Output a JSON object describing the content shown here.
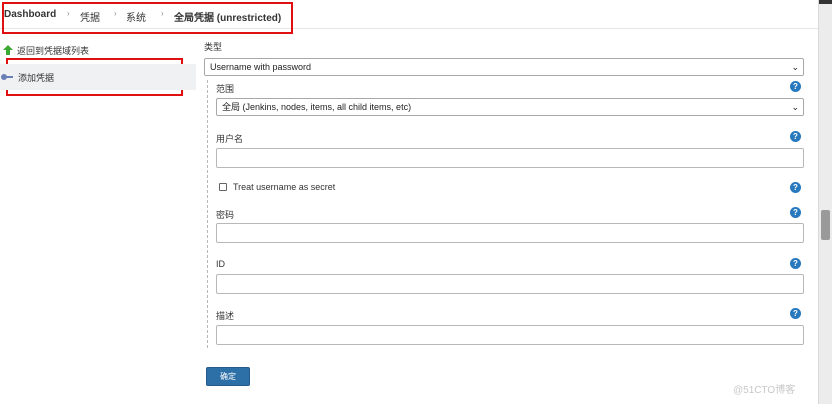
{
  "breadcrumb": {
    "items": [
      "Dashboard",
      "凭据",
      "系统",
      "全局凭据 (unrestricted)"
    ]
  },
  "sidebar": {
    "back_label": "返回到凭据域列表",
    "add_label": "添加凭据"
  },
  "form": {
    "type_label": "类型",
    "type_value": "Username with password",
    "scope_label": "范围",
    "scope_value": "全局 (Jenkins, nodes, items, all child items, etc)",
    "username_label": "用户名",
    "secret_label": "Treat username as secret",
    "password_label": "密码",
    "id_label": "ID",
    "description_label": "描述",
    "submit_label": "确定",
    "help_glyph": "?"
  },
  "watermark": "@51CTO博客",
  "colors": {
    "help": "#2878bd",
    "button": "#2d6fa7",
    "annotation": "#e01010",
    "back_arrow": "#3aa832"
  }
}
